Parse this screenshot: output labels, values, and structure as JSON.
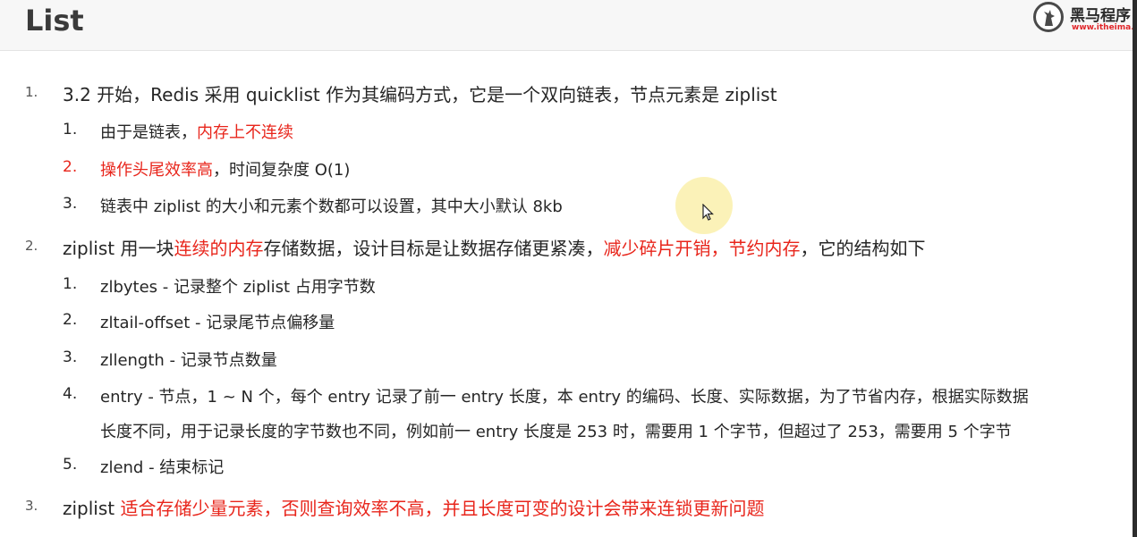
{
  "title": "List",
  "logo": {
    "name": "黑马程序",
    "url": "www.itheima.c"
  },
  "items": [
    {
      "num": "1.",
      "segments": [
        {
          "text": "3.2 开始，Redis 采用 quicklist 作为其编码方式，它是一个双向链表，节点元素是 ziplist",
          "red": false
        }
      ],
      "children": [
        {
          "num": "1.",
          "num_red": false,
          "segments": [
            {
              "text": "由于是链表，",
              "red": false
            },
            {
              "text": "内存上不连续",
              "red": true
            }
          ]
        },
        {
          "num": "2.",
          "num_red": true,
          "segments": [
            {
              "text": "操作头尾效率高",
              "red": true
            },
            {
              "text": "，时间复杂度 O(1)",
              "red": false
            }
          ]
        },
        {
          "num": "3.",
          "num_red": false,
          "segments": [
            {
              "text": "链表中 ziplist 的大小和元素个数都可以设置，其中大小默认 8kb",
              "red": false
            }
          ]
        }
      ]
    },
    {
      "num": "2.",
      "segments": [
        {
          "text": "ziplist 用一块",
          "red": false
        },
        {
          "text": "连续的内存",
          "red": true
        },
        {
          "text": "存储数据，设计目标是让数据存储更紧凑，",
          "red": false
        },
        {
          "text": "减少碎片开销，节约内存",
          "red": true
        },
        {
          "text": "，它的结构如下",
          "red": false
        }
      ],
      "children": [
        {
          "num": "1.",
          "num_red": false,
          "segments": [
            {
              "text": "zlbytes - 记录整个 ziplist 占用字节数",
              "red": false
            }
          ]
        },
        {
          "num": "2.",
          "num_red": false,
          "segments": [
            {
              "text": "zltail-offset - 记录尾节点偏移量",
              "red": false
            }
          ]
        },
        {
          "num": "3.",
          "num_red": false,
          "segments": [
            {
              "text": "zllength - 记录节点数量",
              "red": false
            }
          ]
        },
        {
          "num": "4.",
          "num_red": false,
          "segments": [
            {
              "text": "entry - 节点，1 ~ N 个，每个 entry 记录了前一 entry 长度，本 entry 的编码、长度、实际数据，为了节省内存，根据实际数据",
              "red": false
            }
          ],
          "continuation": "长度不同，用于记录长度的字节数也不同，例如前一 entry 长度是 253 时，需要用 1 个字节，但超过了 253，需要用 5 个字节"
        },
        {
          "num": "5.",
          "num_red": false,
          "segments": [
            {
              "text": "zlend - 结束标记",
              "red": false
            }
          ]
        }
      ]
    },
    {
      "num": "3.",
      "segments": [
        {
          "text": "ziplist ",
          "red": false
        },
        {
          "text": "适合存储少量元素，否则查询效率不高，并且长度可变的设计会带来连锁更新问题",
          "red": true
        }
      ],
      "children": []
    }
  ],
  "colors": {
    "text": "#262626",
    "highlight": "#e8251b",
    "title": "#3a3a3a"
  }
}
